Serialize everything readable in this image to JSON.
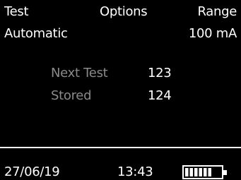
{
  "header": {
    "test_label": "Test",
    "options_label": "Options",
    "range_label": "Range"
  },
  "values": {
    "test_value": "Automatic",
    "range_value": "100 mA"
  },
  "info": {
    "next_test_label": "Next Test",
    "next_test_value": "123",
    "stored_label": "Stored",
    "stored_value": "124"
  },
  "status": {
    "date": "27/06/19",
    "time": "13:43",
    "battery_level": 0.75,
    "battery_icon": "battery-icon"
  },
  "colors": {
    "background": "#000000",
    "foreground": "#ffffff",
    "dim_text": "#8a8a8a"
  }
}
